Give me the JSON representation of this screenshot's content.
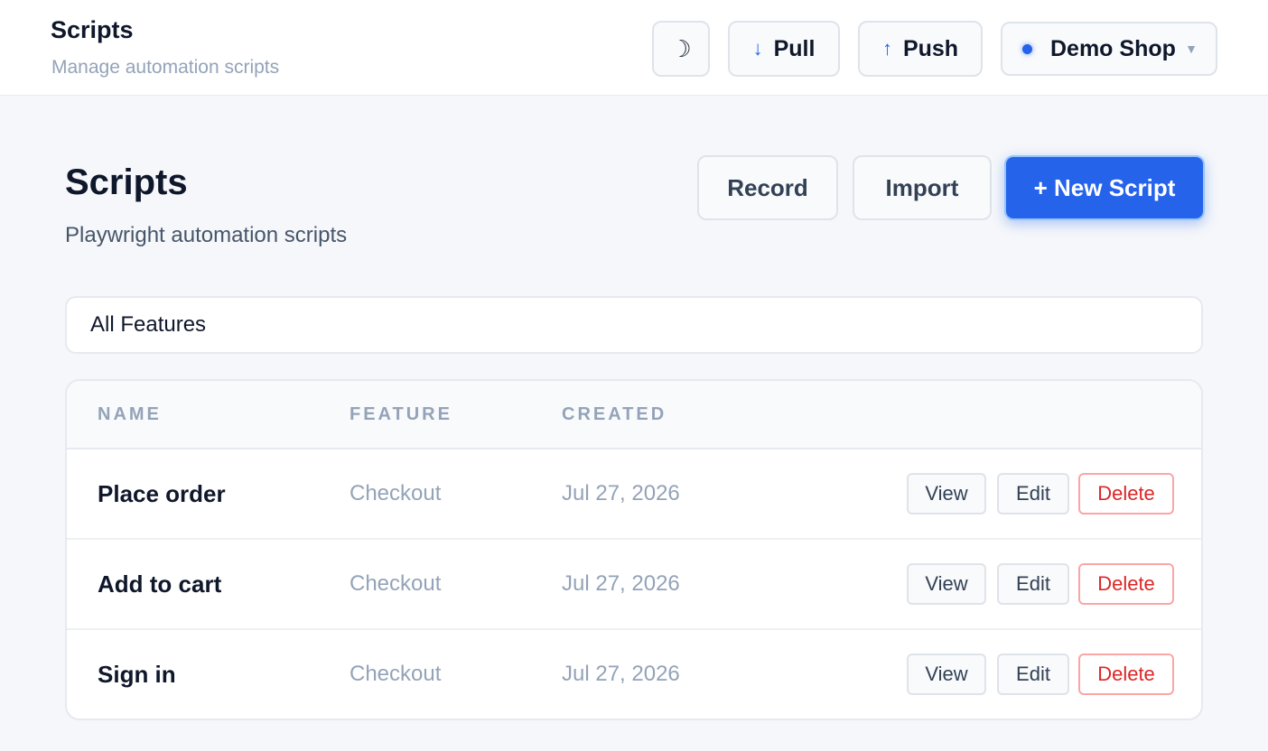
{
  "header": {
    "title": "Scripts",
    "subtitle": "Manage automation scripts",
    "theme_icon": "☽",
    "pull_arrow": "↓",
    "pull_label": "Pull",
    "push_arrow": "↑",
    "push_label": "Push",
    "project": "Demo Shop",
    "project_caret": "▼"
  },
  "page": {
    "title": "Scripts",
    "subtitle": "Playwright automation scripts",
    "record_label": "Record",
    "import_label": "Import",
    "new_label": "+ New Script"
  },
  "filter": {
    "value": "All Features"
  },
  "table": {
    "columns": [
      "NAME",
      "FEATURE",
      "CREATED"
    ],
    "rows": [
      {
        "name": "Place order",
        "feature": "Checkout",
        "created": "Jul 27, 2026"
      },
      {
        "name": "Add to cart",
        "feature": "Checkout",
        "created": "Jul 27, 2026"
      },
      {
        "name": "Sign in",
        "feature": "Checkout",
        "created": "Jul 27, 2026"
      }
    ],
    "actions": {
      "view": "View",
      "edit": "Edit",
      "delete": "Delete"
    }
  },
  "colors": {
    "accent": "#2563eb",
    "danger": "#dc2626",
    "muted": "#94a3b8"
  }
}
